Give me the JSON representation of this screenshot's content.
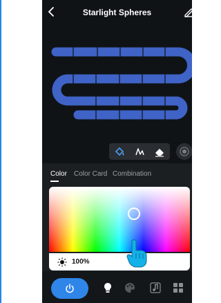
{
  "header": {
    "title": "Starlight Spheres"
  },
  "tabs": [
    {
      "label": "Color"
    },
    {
      "label": "Color Card"
    },
    {
      "label": "Combination"
    }
  ],
  "picker": {
    "brightness_label": "100%"
  },
  "colors": {
    "accent": "#2f86e8",
    "segment": "#3f63c6",
    "background": "#101316",
    "panel": "#1c1f22"
  },
  "icons": {
    "back": "chevron-left-icon",
    "edit": "edit-icon",
    "fill": "paint-bucket-icon",
    "pen": "pen-icon",
    "eraser": "eraser-icon",
    "extra": "target-icon",
    "sun": "sun-icon",
    "power": "power-icon",
    "bulb": "bulb-icon",
    "palette": "palette-icon",
    "music": "music-icon",
    "grid": "grid-icon"
  }
}
